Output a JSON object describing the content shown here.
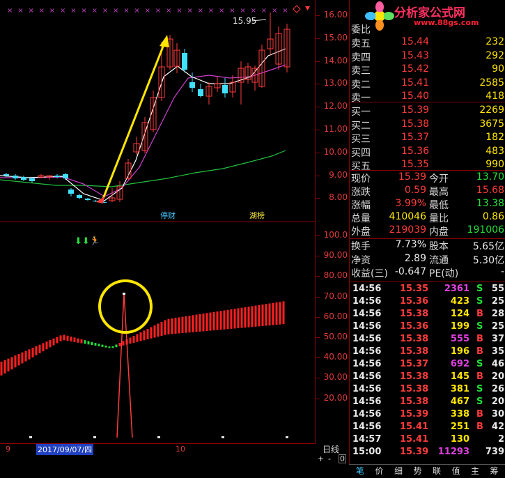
{
  "logo": {
    "text": "分析家公式网",
    "url_text": "www.88gs.com"
  },
  "chart": {
    "high_marker": "15.95",
    "low_marker": "",
    "upper_axis": [
      "16.00",
      "15.00",
      "14.00",
      "13.00",
      "12.00",
      "11.00",
      "10.00",
      "9.00",
      "8.00"
    ],
    "lower_axis": [
      "100.0",
      "90.00",
      "80.00",
      "70.00",
      "60.00",
      "50.00",
      "40.00",
      "30.00",
      "20.00"
    ],
    "tags": {
      "caicai": "停财",
      "xianbang": "湖榜"
    },
    "date_labels": {
      "left": "9",
      "selected": "2017/09/07/四",
      "right": "10"
    },
    "period_label": "日线",
    "zoom_plus": "+",
    "zoom_minus": "-",
    "zoom_zero": "0"
  },
  "quote": {
    "title": "委比",
    "asks": [
      {
        "label": "卖五",
        "price": "15.44",
        "vol": "232"
      },
      {
        "label": "卖四",
        "price": "15.43",
        "vol": "292"
      },
      {
        "label": "卖三",
        "price": "15.42",
        "vol": "90"
      },
      {
        "label": "卖二",
        "price": "15.41",
        "vol": "2585"
      },
      {
        "label": "卖一",
        "price": "15.40",
        "vol": "418"
      }
    ],
    "bids": [
      {
        "label": "买一",
        "price": "15.39",
        "vol": "2269"
      },
      {
        "label": "买二",
        "price": "15.38",
        "vol": "3675"
      },
      {
        "label": "买三",
        "price": "15.37",
        "vol": "182"
      },
      {
        "label": "买四",
        "price": "15.36",
        "vol": "483"
      },
      {
        "label": "买五",
        "price": "15.35",
        "vol": "990"
      }
    ],
    "stats": [
      {
        "l1": "现价",
        "v1": "15.39",
        "l2": "今开",
        "v2": "13.70"
      },
      {
        "l1": "涨跌",
        "v1": "0.59",
        "l2": "最高",
        "v2": "15.68"
      },
      {
        "l1": "涨幅",
        "v1": "3.99%",
        "l2": "最低",
        "v2": "13.38"
      },
      {
        "l1": "总量",
        "v1": "410046",
        "l2": "量比",
        "v2": "0.86"
      },
      {
        "l1": "外盘",
        "v1": "219039",
        "l2": "内盘",
        "v2": "191006"
      }
    ],
    "fin": [
      {
        "l1": "换手",
        "v1": "7.73%",
        "l2": "股本",
        "v2": "5.65亿"
      },
      {
        "l1": "净资",
        "v1": "2.89",
        "l2": "流通",
        "v2": "5.30亿"
      },
      {
        "l1": "收益(三)",
        "v1": "-0.647",
        "l2": "PE(动)",
        "v2": "-"
      }
    ]
  },
  "ticks": [
    {
      "time": "14:56",
      "price": "15.35",
      "vol": "2361",
      "side": "S",
      "n": "55"
    },
    {
      "time": "14:56",
      "price": "15.36",
      "vol": "423",
      "side": "S",
      "n": "25"
    },
    {
      "time": "14:56",
      "price": "15.38",
      "vol": "124",
      "side": "B",
      "n": "28"
    },
    {
      "time": "14:56",
      "price": "15.36",
      "vol": "199",
      "side": "S",
      "n": "25"
    },
    {
      "time": "14:56",
      "price": "15.38",
      "vol": "555",
      "side": "B",
      "n": "37"
    },
    {
      "time": "14:56",
      "price": "15.38",
      "vol": "196",
      "side": "B",
      "n": "35"
    },
    {
      "time": "14:56",
      "price": "15.37",
      "vol": "692",
      "side": "S",
      "n": "46"
    },
    {
      "time": "14:56",
      "price": "15.38",
      "vol": "145",
      "side": "B",
      "n": "20"
    },
    {
      "time": "14:56",
      "price": "15.38",
      "vol": "381",
      "side": "S",
      "n": "26"
    },
    {
      "time": "14:56",
      "price": "15.38",
      "vol": "467",
      "side": "S",
      "n": "20"
    },
    {
      "time": "14:56",
      "price": "15.39",
      "vol": "338",
      "side": "B",
      "n": "30"
    },
    {
      "time": "14:56",
      "price": "15.41",
      "vol": "251",
      "side": "B",
      "n": "42"
    },
    {
      "time": "14:57",
      "price": "15.41",
      "vol": "130",
      "side": "",
      "n": "2"
    },
    {
      "time": "15:00",
      "price": "15.39",
      "vol": "11293",
      "side": "",
      "n": "739"
    }
  ],
  "tabs": [
    "笔",
    "价",
    "细",
    "势",
    "联",
    "值",
    "主",
    "筹"
  ],
  "colors": {
    "up": "#ff3b3b",
    "down": "#22e03a",
    "bg": "#000000",
    "grid": "#880000",
    "highlight": "#ffe600"
  }
}
